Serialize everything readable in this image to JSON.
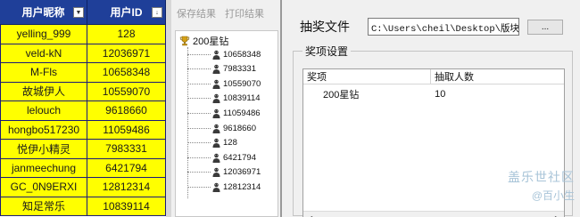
{
  "spreadsheet": {
    "headers": [
      "用户昵称",
      "用户ID"
    ],
    "rows": [
      [
        "yelling_999",
        "128"
      ],
      [
        "veld-kN",
        "12036971"
      ],
      [
        "M-Fls",
        "10658348"
      ],
      [
        "故城伊人",
        "10559070"
      ],
      [
        "lelouch",
        "9618660"
      ],
      [
        "hongbo517230",
        "11059486"
      ],
      [
        "悦伊小精灵",
        "7983331"
      ],
      [
        "janmeechung",
        "6421794"
      ],
      [
        "GC_0N9ERXI",
        "12812314"
      ],
      [
        "知足常乐",
        "10839114"
      ]
    ],
    "colors": {
      "header_bg": "#1f3f99",
      "row_bg": "#ffff00"
    }
  },
  "results_panel": {
    "save_label": "保存结果",
    "print_label": "打印结果",
    "tree_root": "200星钻",
    "tree_items": [
      "10658348",
      "7983331",
      "10559070",
      "10839114",
      "11059486",
      "9618660",
      "128",
      "6421794",
      "12036971",
      "12812314"
    ]
  },
  "dialog": {
    "file_label": "抽奖文件",
    "file_path": "C:\\Users\\cheil\\Desktop\\版块活",
    "browse_label": "...",
    "group_title": "奖项设置",
    "table_headers": [
      "奖项",
      "抽取人数"
    ],
    "table_rows": [
      [
        "200星钻",
        "10"
      ]
    ]
  },
  "watermark": {
    "main": "盖乐世社区",
    "sub": "@百小生"
  }
}
